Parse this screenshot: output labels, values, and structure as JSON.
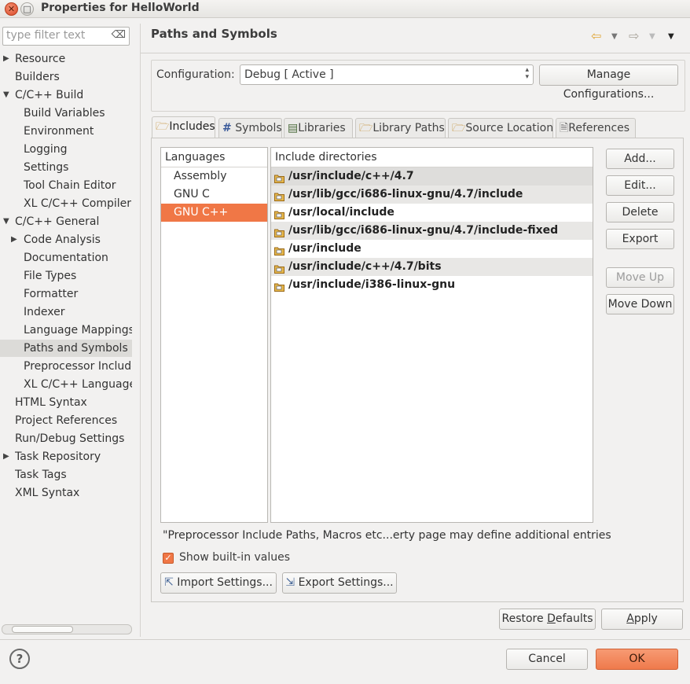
{
  "window": {
    "title": "Properties for HelloWorld"
  },
  "filter": {
    "placeholder": "type filter text"
  },
  "tree": [
    {
      "label": "Resource",
      "level": 0,
      "arrow": "right"
    },
    {
      "label": "Builders",
      "level": 0,
      "arrow": ""
    },
    {
      "label": "C/C++ Build",
      "level": 0,
      "arrow": "down"
    },
    {
      "label": "Build Variables",
      "level": 1,
      "arrow": ""
    },
    {
      "label": "Environment",
      "level": 1,
      "arrow": ""
    },
    {
      "label": "Logging",
      "level": 1,
      "arrow": ""
    },
    {
      "label": "Settings",
      "level": 1,
      "arrow": ""
    },
    {
      "label": "Tool Chain Editor",
      "level": 1,
      "arrow": ""
    },
    {
      "label": "XL C/C++ Compiler",
      "level": 1,
      "arrow": ""
    },
    {
      "label": "C/C++ General",
      "level": 0,
      "arrow": "down"
    },
    {
      "label": "Code Analysis",
      "level": 1,
      "arrow": "right"
    },
    {
      "label": "Documentation",
      "level": 1,
      "arrow": ""
    },
    {
      "label": "File Types",
      "level": 1,
      "arrow": ""
    },
    {
      "label": "Formatter",
      "level": 1,
      "arrow": ""
    },
    {
      "label": "Indexer",
      "level": 1,
      "arrow": ""
    },
    {
      "label": "Language Mappings",
      "level": 1,
      "arrow": ""
    },
    {
      "label": "Paths and Symbols",
      "level": 1,
      "arrow": "",
      "selected": true
    },
    {
      "label": "Preprocessor Include",
      "level": 1,
      "arrow": ""
    },
    {
      "label": "XL C/C++ Language C",
      "level": 1,
      "arrow": ""
    },
    {
      "label": "HTML Syntax",
      "level": 0,
      "arrow": ""
    },
    {
      "label": "Project References",
      "level": 0,
      "arrow": ""
    },
    {
      "label": "Run/Debug Settings",
      "level": 0,
      "arrow": ""
    },
    {
      "label": "Task Repository",
      "level": 0,
      "arrow": "right"
    },
    {
      "label": "Task Tags",
      "level": 0,
      "arrow": ""
    },
    {
      "label": "XML Syntax",
      "level": 0,
      "arrow": ""
    }
  ],
  "page": {
    "title": "Paths and Symbols"
  },
  "config": {
    "label": "Configuration:",
    "value": "Debug  [ Active ]",
    "manage_label": "Manage Configurations..."
  },
  "tabs": [
    {
      "label": "Includes",
      "icon": "includes-icon",
      "active": true
    },
    {
      "label": "Symbols",
      "icon": "hash-icon"
    },
    {
      "label": "Libraries",
      "icon": "library-icon"
    },
    {
      "label": "Library Paths",
      "icon": "folder-icon"
    },
    {
      "label": "Source Location",
      "icon": "folder-icon"
    },
    {
      "label": "References",
      "icon": "references-icon"
    }
  ],
  "languages": {
    "header": "Languages",
    "items": [
      "Assembly",
      "GNU C",
      "GNU C++"
    ],
    "selected": "GNU C++"
  },
  "includes": {
    "header": "Include directories",
    "items": [
      "/usr/include/c++/4.7",
      "/usr/lib/gcc/i686-linux-gnu/4.7/include",
      "/usr/local/include",
      "/usr/lib/gcc/i686-linux-gnu/4.7/include-fixed",
      "/usr/include",
      "/usr/include/c++/4.7/bits",
      "/usr/include/i386-linux-gnu"
    ]
  },
  "side_buttons": {
    "add": "Add...",
    "edit": "Edit...",
    "delete": "Delete",
    "export": "Export",
    "move_up": "Move Up",
    "move_down": "Move Down"
  },
  "note": "\"Preprocessor Include Paths, Macros etc...erty page may define additional entries",
  "show_builtin": {
    "label": "Show built-in values",
    "checked": true
  },
  "import_label": "Import Settings...",
  "export_label": "Export Settings...",
  "restore_prefix": "Restore ",
  "restore_ul": "D",
  "restore_suffix": "efaults",
  "apply_ul": "A",
  "apply_rest": "pply",
  "cancel_label": "Cancel",
  "ok_label": "OK",
  "colors": {
    "accent": "#f07746",
    "selection": "#dcdbd8"
  }
}
